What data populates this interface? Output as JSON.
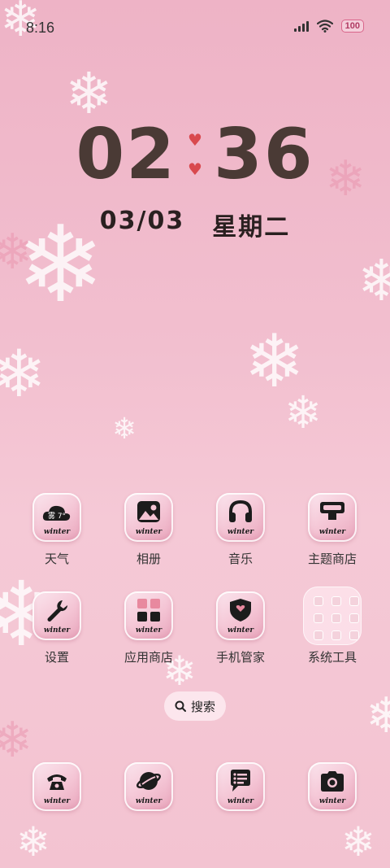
{
  "status_bar": {
    "time": "8:16",
    "battery": "100"
  },
  "clock": {
    "hours": "02",
    "minutes": "36",
    "date": "03/03",
    "weekday": "星期二"
  },
  "apps": [
    {
      "label": "天气",
      "icon": "weather-icon",
      "badge": "雾 7°"
    },
    {
      "label": "相册",
      "icon": "gallery-icon"
    },
    {
      "label": "音乐",
      "icon": "music-icon"
    },
    {
      "label": "主题商店",
      "icon": "theme-store-icon"
    },
    {
      "label": "设置",
      "icon": "settings-icon"
    },
    {
      "label": "应用商店",
      "icon": "app-store-icon"
    },
    {
      "label": "手机管家",
      "icon": "phone-manager-icon"
    },
    {
      "label": "系统工具",
      "icon": "system-tools-folder"
    }
  ],
  "icon_caption": "winter",
  "search": {
    "label": "搜索"
  },
  "dock": [
    {
      "icon": "phone-icon"
    },
    {
      "icon": "browser-icon"
    },
    {
      "icon": "messages-icon"
    },
    {
      "icon": "camera-icon"
    }
  ],
  "colors": {
    "digits": "#4a3a35",
    "heart": "#d9494e",
    "background": "#f2bfcf"
  }
}
